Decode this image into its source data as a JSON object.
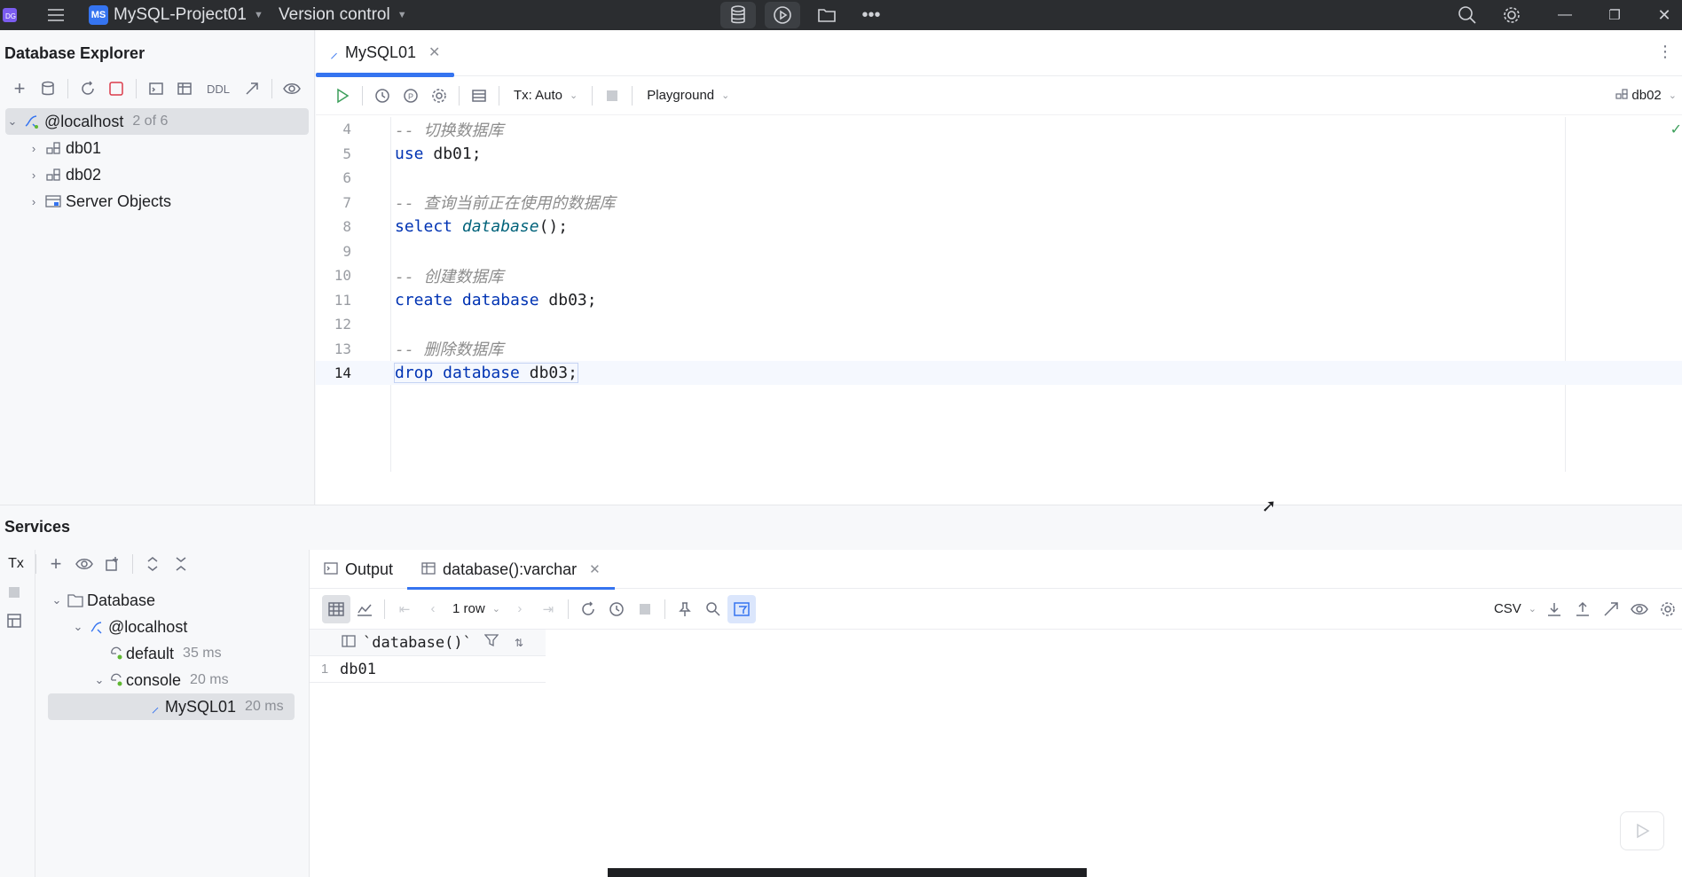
{
  "topbar": {
    "project_badge": "MS",
    "project_name": "MySQL-Project01",
    "vcs": "Version control"
  },
  "db_explorer": {
    "title": "Database Explorer",
    "toolbar_ddl": "DDL",
    "tree": [
      {
        "label": "@localhost",
        "extra": "2 of 6"
      },
      {
        "label": "db01"
      },
      {
        "label": "db02"
      },
      {
        "label": "Server Objects"
      }
    ]
  },
  "editor": {
    "tab_label": "MySQL01",
    "tx_mode": "Tx: Auto",
    "playground": "Playground",
    "schema": "db02",
    "lines": [
      {
        "num": "4",
        "text": "-- 切换数据库"
      },
      {
        "num": "5",
        "kw": "use",
        "rest": " db01;"
      },
      {
        "num": "6",
        "text": ""
      },
      {
        "num": "7",
        "text": "-- 查询当前正在使用的数据库"
      },
      {
        "num": "8",
        "kw": "select",
        "fn": "database",
        "rest": "();"
      },
      {
        "num": "9",
        "text": ""
      },
      {
        "num": "10",
        "text": "-- 创建数据库"
      },
      {
        "num": "11",
        "kw": "create database",
        "rest": " db03;"
      },
      {
        "num": "12",
        "text": ""
      },
      {
        "num": "13",
        "text": "-- 删除数据库"
      },
      {
        "num": "14",
        "kw": "drop database",
        "rest": " db03;"
      }
    ]
  },
  "services": {
    "title": "Services",
    "tx_label": "Tx",
    "tree": [
      {
        "label": "Database"
      },
      {
        "label": "@localhost"
      },
      {
        "label": "default",
        "time": "35 ms"
      },
      {
        "label": "console",
        "time": "20 ms"
      },
      {
        "label": "MySQL01",
        "time": "20 ms"
      }
    ],
    "tabs": [
      "Output",
      "database():varchar"
    ],
    "row_count": "1 row",
    "export_format": "CSV",
    "column_header": "`database()`",
    "rows": [
      {
        "num": "1",
        "value": "db01"
      }
    ]
  }
}
